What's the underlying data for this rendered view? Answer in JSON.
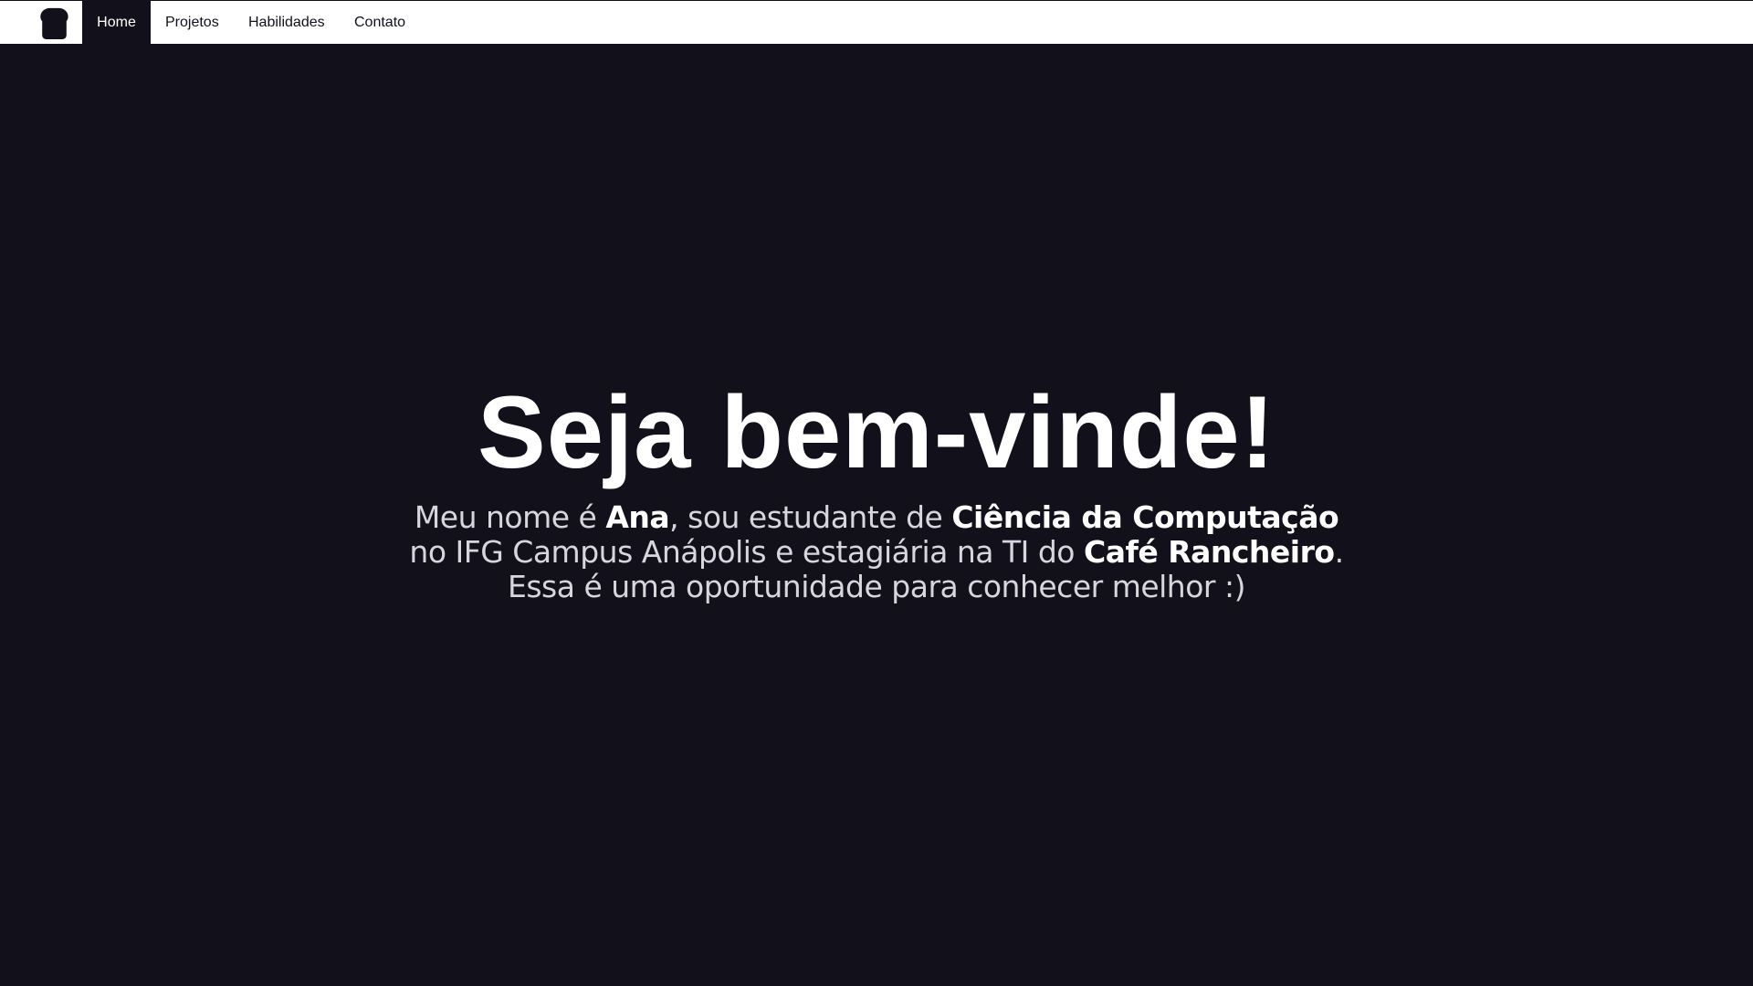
{
  "nav": {
    "logo_icon": "bread-icon",
    "items": [
      {
        "label": "Home",
        "active": true
      },
      {
        "label": "Projetos",
        "active": false
      },
      {
        "label": "Habilidades",
        "active": false
      },
      {
        "label": "Contato",
        "active": false
      }
    ]
  },
  "hero": {
    "title": "Seja bem-vinde!",
    "line1": {
      "a": "Meu nome é ",
      "name": "Ana",
      "b": ", sou estudante de ",
      "course": "Ciência da Computação"
    },
    "line2": {
      "a": "no IFG Campus Anápolis e estagiária na TI do ",
      "company": "Café Rancheiro",
      "b": "."
    },
    "line3": "Essa é uma oportunidade para conhecer melhor :)"
  },
  "colors": {
    "background": "#12111b",
    "nav_background": "#ffffff",
    "text": "#ffffff",
    "muted_text": "#d7d6dc"
  }
}
